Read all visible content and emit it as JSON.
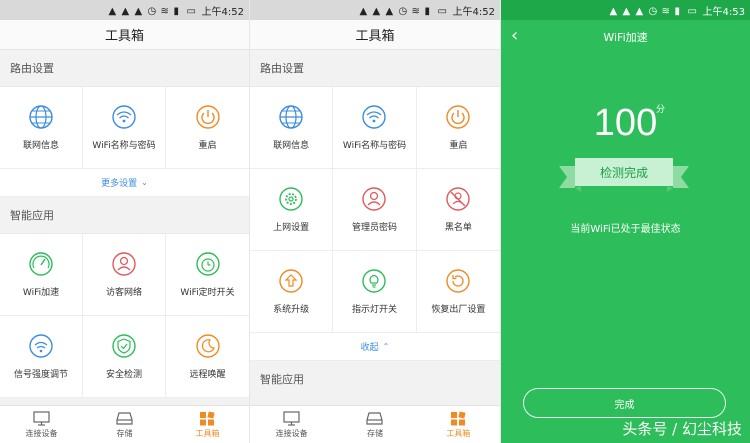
{
  "status_time_a": "上午4:52",
  "status_time_b": "上午4:53",
  "toolbox_title": "工具箱",
  "section_router": "路由设置",
  "section_smart": "智能应用",
  "more_settings": "更多设置",
  "collapse": "收起",
  "router_short": [
    {
      "label": "联网信息",
      "icon": "globe-icon",
      "color": "#3b8ce0"
    },
    {
      "label": "WiFi名称与密码",
      "icon": "wifi-icon",
      "color": "#3b8ce0"
    },
    {
      "label": "重启",
      "icon": "power-icon",
      "color": "#f08a24"
    }
  ],
  "smart_apps": [
    {
      "label": "WiFi加速",
      "icon": "speedometer-icon",
      "color": "#2dbd5a"
    },
    {
      "label": "访客网络",
      "icon": "guest-icon",
      "color": "#e05a5a"
    },
    {
      "label": "WiFi定时开关",
      "icon": "timer-icon",
      "color": "#2dbd5a"
    },
    {
      "label": "信号强度调节",
      "icon": "signal-icon",
      "color": "#3b8ce0"
    },
    {
      "label": "安全检测",
      "icon": "shield-icon",
      "color": "#2dbd5a"
    },
    {
      "label": "远程唤醒",
      "icon": "moon-icon",
      "color": "#f08a24"
    }
  ],
  "router_full": [
    {
      "label": "联网信息",
      "icon": "globe-icon",
      "color": "#3b8ce0"
    },
    {
      "label": "WiFi名称与密码",
      "icon": "wifi-icon",
      "color": "#3b8ce0"
    },
    {
      "label": "重启",
      "icon": "power-icon",
      "color": "#f08a24"
    },
    {
      "label": "上网设置",
      "icon": "gear-icon",
      "color": "#2dbd5a"
    },
    {
      "label": "管理员密码",
      "icon": "admin-icon",
      "color": "#e05a5a"
    },
    {
      "label": "黑名单",
      "icon": "blacklist-icon",
      "color": "#e05a5a"
    },
    {
      "label": "系统升级",
      "icon": "upgrade-icon",
      "color": "#f08a24"
    },
    {
      "label": "指示灯开关",
      "icon": "lamp-icon",
      "color": "#2dbd5a"
    },
    {
      "label": "恢复出厂设置",
      "icon": "reset-icon",
      "color": "#f08a24"
    }
  ],
  "tabs": [
    {
      "label": "连接设备",
      "icon": "monitor-icon"
    },
    {
      "label": "存储",
      "icon": "storage-icon"
    },
    {
      "label": "工具箱",
      "icon": "toolbox-icon",
      "active": true
    }
  ],
  "accel": {
    "title": "WiFi加速",
    "score": "100",
    "unit": "分",
    "badge": "检测完成",
    "message": "当前WiFi已处于最佳状态",
    "done": "完成"
  },
  "watermark": "头条号 / 幻尘科技",
  "colors": {
    "green": "#2dbd5a",
    "blue": "#3b8ce0",
    "orange": "#f08a24",
    "red": "#e05a5a"
  }
}
